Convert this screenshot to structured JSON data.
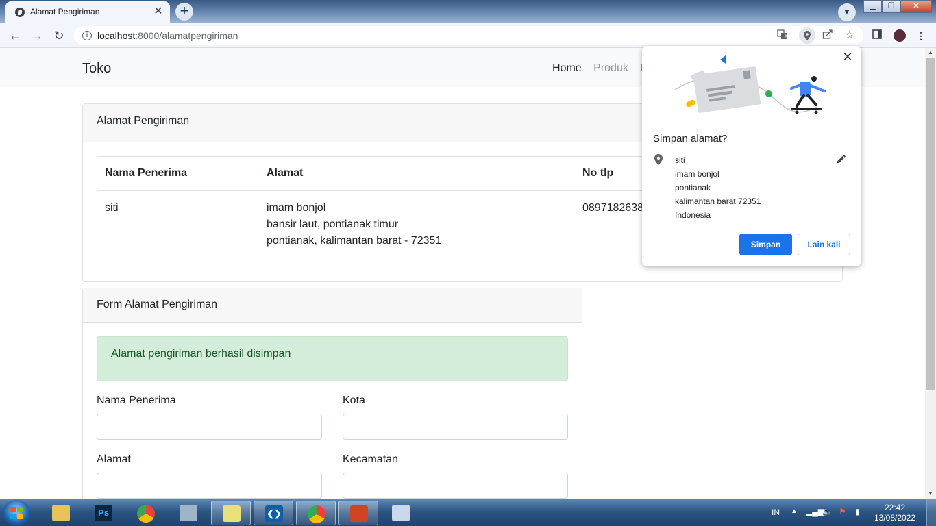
{
  "browser": {
    "tab_title": "Alamat Pengiriman",
    "tab_close": "✕",
    "new_tab": "+",
    "url_host": "localhost",
    "url_path": ":8000/alamatpengiriman"
  },
  "navbar": {
    "brand": "Toko",
    "links": [
      "Home",
      "Produk",
      "K"
    ]
  },
  "address_card": {
    "header": "Alamat Pengiriman",
    "columns": [
      "Nama Penerima",
      "Alamat",
      "No tlp"
    ],
    "row": {
      "name": "siti",
      "address_lines": [
        "imam bonjol",
        "bansir laut, pontianak timur",
        "pontianak, kalimantan barat - 72351"
      ],
      "phone": "0897182638"
    }
  },
  "form_card": {
    "header": "Form Alamat Pengiriman",
    "alert": "Alamat pengiriman berhasil disimpan",
    "labels": {
      "nama_penerima": "Nama Penerima",
      "kota": "Kota",
      "alamat": "Alamat",
      "kecamatan": "Kecamatan"
    },
    "values": {
      "nama_penerima": "",
      "kota": "",
      "alamat": "",
      "kecamatan": ""
    }
  },
  "save_popup": {
    "title": "Simpan alamat?",
    "close": "✕",
    "address_lines": [
      "siti",
      "imam bonjol",
      "pontianak",
      "kalimantan barat 72351",
      "Indonesia"
    ],
    "save_label": "Simpan",
    "later_label": "Lain kali",
    "accent": "#1a73e8"
  },
  "taskbar": {
    "lang": "IN",
    "time": "22:42",
    "date": "13/08/2022"
  }
}
